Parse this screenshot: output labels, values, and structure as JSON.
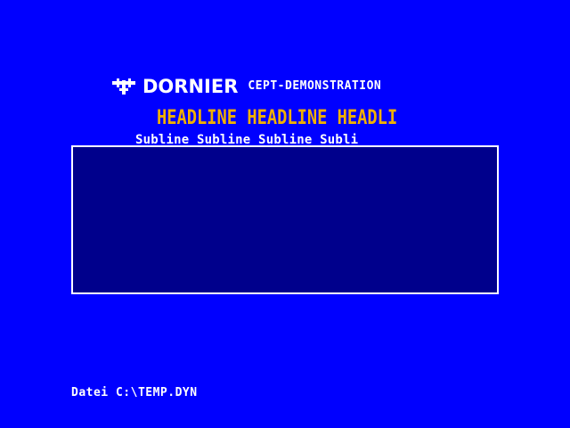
{
  "brand": {
    "logo_icon": "dornier-logo-icon",
    "name": "DORNIER",
    "title": "CEPT-DEMONSTRATION"
  },
  "content": {
    "headline": "HEADLINE HEADLINE HEADLI",
    "subline": "Subline Subline Subline Subli"
  },
  "footer": {
    "file_label": "Datei C:\\TEMP.DYN"
  },
  "colors": {
    "background": "#0000ff",
    "frame_fill": "#00008c",
    "headline": "#f0b000",
    "text": "#ffffff"
  }
}
